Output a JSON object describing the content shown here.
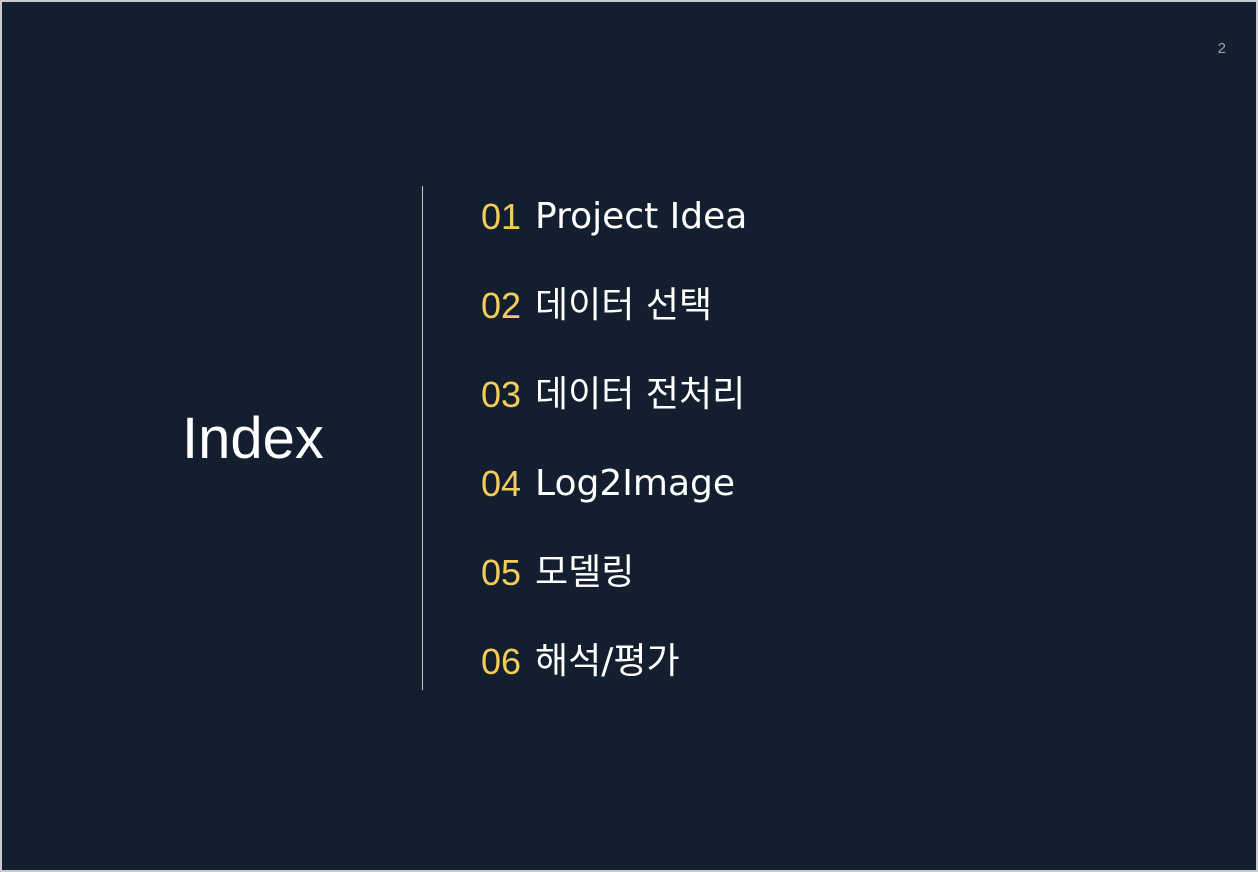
{
  "slide": {
    "page_number": "2",
    "title": "Index",
    "items": [
      {
        "number": "01",
        "label": "Project Idea"
      },
      {
        "number": "02",
        "label": "데이터 선택"
      },
      {
        "number": "03",
        "label": "데이터 전처리"
      },
      {
        "number": "04",
        "label": "Log2Image"
      },
      {
        "number": "05",
        "label": "모델링"
      },
      {
        "number": "06",
        "label": "해석/평가"
      }
    ]
  },
  "colors": {
    "background": "#131f2e",
    "accent_numbers": "#f3cc5b",
    "text": "#ffffff",
    "divider": "#c7cbd1"
  }
}
